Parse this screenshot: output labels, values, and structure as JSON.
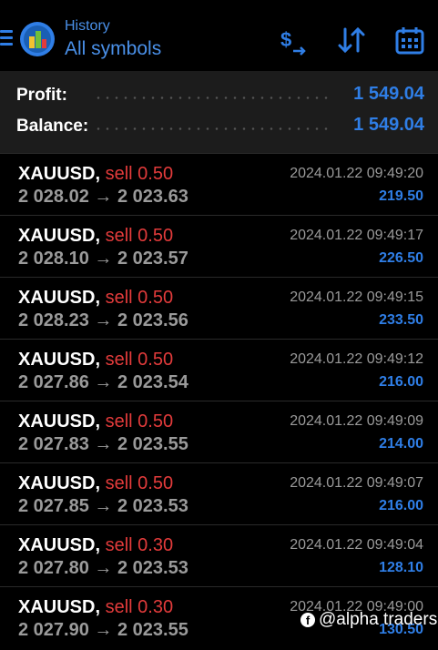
{
  "header": {
    "subtitle": "History",
    "title": "All symbols",
    "accent_color": "#2f7ee6",
    "icons": [
      "menu-icon",
      "app-logo-icon",
      "currency-sort-icon",
      "sort-arrows-icon",
      "calendar-icon"
    ]
  },
  "summary": {
    "profit_label": "Profit:",
    "profit_value": "1 549.04",
    "balance_label": "Balance:",
    "balance_value": "1 549.04"
  },
  "deals": [
    {
      "symbol": "XAUUSD,",
      "action": "sell 0.50",
      "prices": "2 028.02 → 2 023.63",
      "time": "2024.01.22 09:49:20",
      "profit": "219.50"
    },
    {
      "symbol": "XAUUSD,",
      "action": "sell 0.50",
      "prices": "2 028.10 → 2 023.57",
      "time": "2024.01.22 09:49:17",
      "profit": "226.50"
    },
    {
      "symbol": "XAUUSD,",
      "action": "sell 0.50",
      "prices": "2 028.23 → 2 023.56",
      "time": "2024.01.22 09:49:15",
      "profit": "233.50"
    },
    {
      "symbol": "XAUUSD,",
      "action": "sell 0.50",
      "prices": "2 027.86 → 2 023.54",
      "time": "2024.01.22 09:49:12",
      "profit": "216.00"
    },
    {
      "symbol": "XAUUSD,",
      "action": "sell 0.50",
      "prices": "2 027.83 → 2 023.55",
      "time": "2024.01.22 09:49:09",
      "profit": "214.00"
    },
    {
      "symbol": "XAUUSD,",
      "action": "sell 0.50",
      "prices": "2 027.85 → 2 023.53",
      "time": "2024.01.22 09:49:07",
      "profit": "216.00"
    },
    {
      "symbol": "XAUUSD,",
      "action": "sell 0.30",
      "prices": "2 027.80 → 2 023.53",
      "time": "2024.01.22 09:49:04",
      "profit": "128.10"
    },
    {
      "symbol": "XAUUSD,",
      "action": "sell 0.30",
      "prices": "2 027.90 → 2 023.55",
      "time": "2024.01.22 09:49:00",
      "profit": "130.50"
    }
  ],
  "watermark": {
    "text": "@alpha traders",
    "icon": "facebook-icon"
  }
}
